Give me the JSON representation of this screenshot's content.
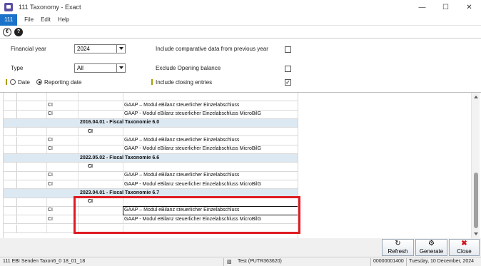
{
  "window": {
    "title": "111 Taxonomy - Exact",
    "minimize": "—",
    "maximize": "☐",
    "close": "✕"
  },
  "menu": {
    "tab": "111",
    "items": [
      "File",
      "Edit",
      "Help"
    ]
  },
  "toolbar": {
    "icon1": "€",
    "icon2": "?"
  },
  "form": {
    "financial_year_label": "Financial year",
    "financial_year_value": "2024",
    "type_label": "Type",
    "type_value": "All",
    "include_comparative_label": "Include comparative data from previous year",
    "include_comparative_checked": false,
    "exclude_opening_label": "Exclude Opening balance",
    "exclude_opening_checked": false,
    "radio_date_label": "Date",
    "radio_reporting_label": "Reporting date",
    "radio_selected": "Reporting date",
    "include_closing_label": "Include closing entries",
    "include_closing_checked": true,
    "checkmark": "✓"
  },
  "grid": {
    "rows": [
      {
        "kind": "header",
        "c1": "",
        "c2": "",
        "c3": ""
      },
      {
        "kind": "item",
        "c1": "CI",
        "c3": "GAAP – Modul eBilanz steuerlicher Einzelabschluss"
      },
      {
        "kind": "item",
        "c1": "CI",
        "c3": "GAAP - Modul eBilanz steuerlicher Einzelabschluss MicroBilG"
      },
      {
        "kind": "group",
        "title": "2016.04.01 - Fiscal Taxonomie 6.0"
      },
      {
        "kind": "sub",
        "c2": "CI"
      },
      {
        "kind": "item",
        "c1": "CI",
        "c3": "GAAP – Modul eBilanz steuerlicher Einzelabschluss"
      },
      {
        "kind": "item",
        "c1": "CI",
        "c3": "GAAP - Modul eBilanz steuerlicher Einzelabschluss MicroBilG"
      },
      {
        "kind": "group",
        "title": "2022.05.02 - Fiscal Taxonomie 6.6"
      },
      {
        "kind": "sub",
        "c2": "CI"
      },
      {
        "kind": "item",
        "c1": "CI",
        "c3": "GAAP – Modul eBilanz steuerlicher Einzelabschluss"
      },
      {
        "kind": "item",
        "c1": "CI",
        "c3": "GAAP - Modul eBilanz steuerlicher Einzelabschluss MicroBilG"
      },
      {
        "kind": "group",
        "title": "2023.04.01 - Fiscal Taxonomie 6.7"
      },
      {
        "kind": "sub",
        "c2": "CI"
      },
      {
        "kind": "item",
        "c1": "CI",
        "c3": "GAAP – Modul eBilanz steuerlicher Einzelabschluss",
        "selected": true
      },
      {
        "kind": "item",
        "c1": "CI",
        "c3": "GAAP - Modul eBilanz steuerlicher Einzelabschluss MicroBilG"
      },
      {
        "kind": "empty"
      }
    ]
  },
  "buttons": {
    "refresh": "Refresh",
    "generate": "Generate",
    "close": "Close",
    "refresh_icon": "↻",
    "generate_icon": "⚙",
    "close_icon": "✖"
  },
  "status": {
    "left": "111 EBI Senden Taxon6_0 18_01_18",
    "user": "Test (PUTR363620)",
    "code": "00000001400",
    "date": "Tuesday, 10 December, 2024"
  },
  "colors": {
    "accent": "#1a73c8",
    "group_row": "#dce8f2",
    "highlight": "#e01a22"
  }
}
